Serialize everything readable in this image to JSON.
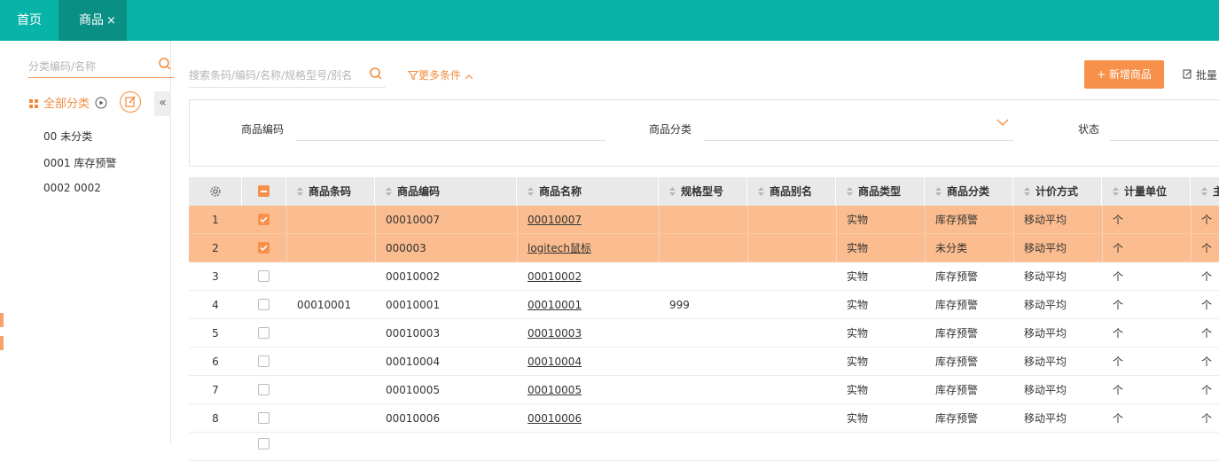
{
  "tabs": [
    {
      "label": "首页"
    },
    {
      "label": "商品",
      "close": "×"
    }
  ],
  "sidebar": {
    "search_placeholder": "分类编码/名称",
    "all_label": "全部分类",
    "items": [
      "00 未分类",
      "0001 库存预警",
      "0002 0002"
    ],
    "collapse_glyph": "«"
  },
  "toolbar": {
    "search_placeholder": "搜索条码/编码/名称/规格型号/别名",
    "more_label": "更多条件",
    "add_label": "+ 新增商品",
    "batch_label": "批量"
  },
  "filters": {
    "code_label": "商品编码",
    "category_label": "商品分类",
    "status_label": "状态"
  },
  "table": {
    "columns": [
      "商品条码",
      "商品编码",
      "商品名称",
      "规格型号",
      "商品别名",
      "商品类型",
      "商品分类",
      "计价方式",
      "计量单位",
      "主"
    ],
    "rows": [
      {
        "n": "1",
        "checked": true,
        "barcode": "",
        "code": "00010007",
        "name": "00010007",
        "spec": "",
        "alias": "",
        "type": "实物",
        "category": "库存预警",
        "pricing": "移动平均",
        "unit": "个",
        "main": "个"
      },
      {
        "n": "2",
        "checked": true,
        "barcode": "",
        "code": "000003",
        "name": "logitech鼠标",
        "spec": "",
        "alias": "",
        "type": "实物",
        "category": "未分类",
        "pricing": "移动平均",
        "unit": "个",
        "main": "个"
      },
      {
        "n": "3",
        "checked": false,
        "barcode": "",
        "code": "00010002",
        "name": "00010002",
        "spec": "",
        "alias": "",
        "type": "实物",
        "category": "库存预警",
        "pricing": "移动平均",
        "unit": "个",
        "main": "个"
      },
      {
        "n": "4",
        "checked": false,
        "barcode": "00010001",
        "code": "00010001",
        "name": "00010001",
        "spec": "999",
        "alias": "",
        "type": "实物",
        "category": "库存预警",
        "pricing": "移动平均",
        "unit": "个",
        "main": "个"
      },
      {
        "n": "5",
        "checked": false,
        "barcode": "",
        "code": "00010003",
        "name": "00010003",
        "spec": "",
        "alias": "",
        "type": "实物",
        "category": "库存预警",
        "pricing": "移动平均",
        "unit": "个",
        "main": "个"
      },
      {
        "n": "6",
        "checked": false,
        "barcode": "",
        "code": "00010004",
        "name": "00010004",
        "spec": "",
        "alias": "",
        "type": "实物",
        "category": "库存预警",
        "pricing": "移动平均",
        "unit": "个",
        "main": "个"
      },
      {
        "n": "7",
        "checked": false,
        "barcode": "",
        "code": "00010005",
        "name": "00010005",
        "spec": "",
        "alias": "",
        "type": "实物",
        "category": "库存预警",
        "pricing": "移动平均",
        "unit": "个",
        "main": "个"
      },
      {
        "n": "8",
        "checked": false,
        "barcode": "",
        "code": "00010006",
        "name": "00010006",
        "spec": "",
        "alias": "",
        "type": "实物",
        "category": "库存预警",
        "pricing": "移动平均",
        "unit": "个",
        "main": "个"
      }
    ]
  },
  "colors": {
    "teal": "#08b4a8",
    "teal_dark": "#0a8f85",
    "accent": "#f7904a",
    "selected_row": "#fbbd8f"
  }
}
